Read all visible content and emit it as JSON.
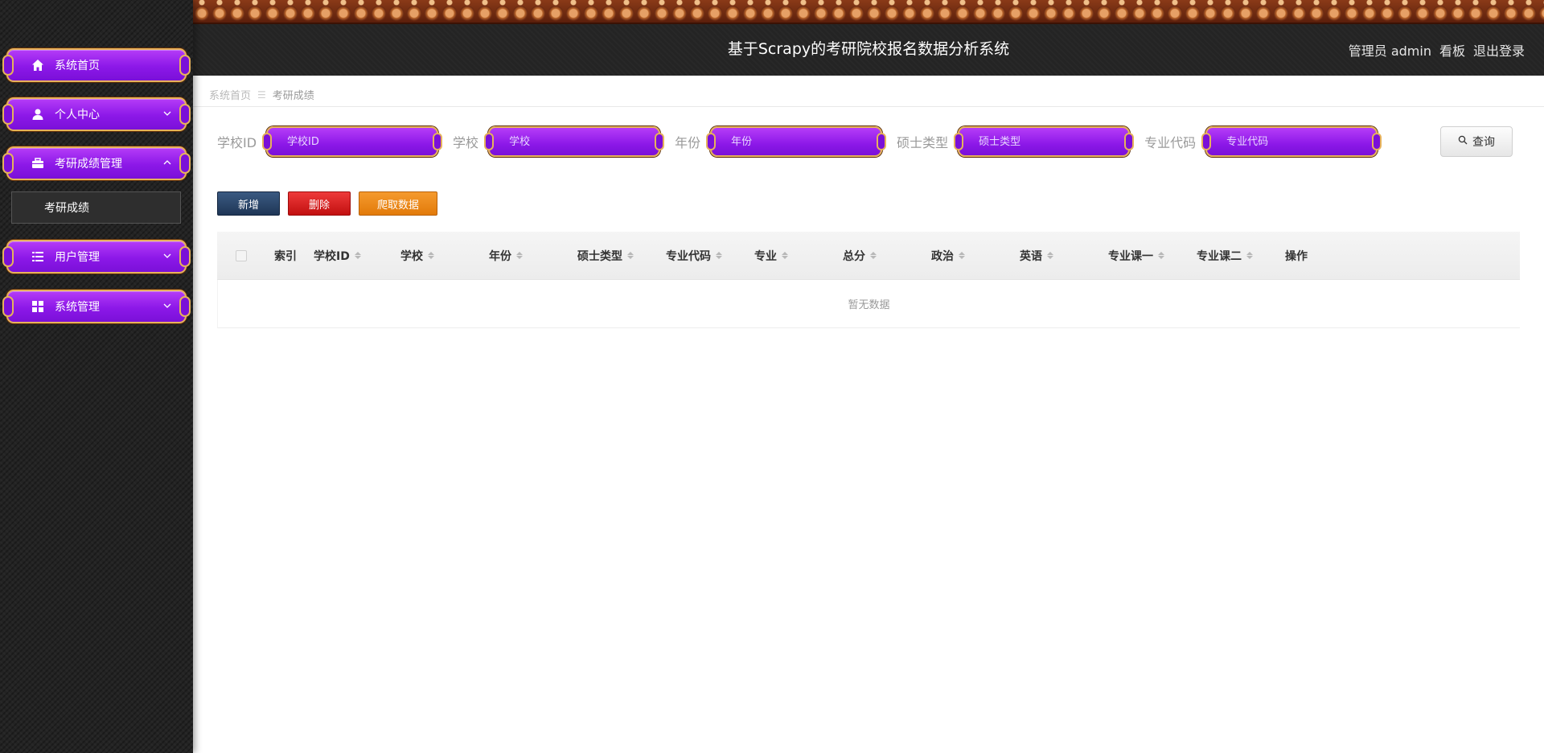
{
  "header": {
    "title": "基于Scrapy的考研院校报名数据分析系统",
    "user": "管理员 admin",
    "dashboard": "看板",
    "logout": "退出登录"
  },
  "sidebar": {
    "items": [
      {
        "label": "系统首页",
        "icon": "home-icon"
      },
      {
        "label": "个人中心",
        "icon": "user-icon"
      },
      {
        "label": "考研成绩管理",
        "icon": "briefcase-icon"
      },
      {
        "label": "用户管理",
        "icon": "list-icon"
      },
      {
        "label": "系统管理",
        "icon": "grid-icon"
      }
    ],
    "sub_item": "考研成绩"
  },
  "breadcrumb": {
    "home": "系统首页",
    "separator": "☰",
    "current": "考研成绩"
  },
  "filters": {
    "school_id": {
      "label": "学校ID",
      "placeholder": "学校ID"
    },
    "school": {
      "label": "学校",
      "placeholder": "学校"
    },
    "year": {
      "label": "年份",
      "placeholder": "年份"
    },
    "degree_type": {
      "label": "硕士类型",
      "placeholder": "硕士类型"
    },
    "major_code": {
      "label": "专业代码",
      "placeholder": "专业代码"
    },
    "search_label": "查询"
  },
  "actions": {
    "add": "新增",
    "delete": "删除",
    "crawl": "爬取数据"
  },
  "table": {
    "columns": [
      "索引",
      "学校ID",
      "学校",
      "年份",
      "硕士类型",
      "专业代码",
      "专业",
      "总分",
      "政治",
      "英语",
      "专业课一",
      "专业课二",
      "操作"
    ],
    "empty": "暂无数据"
  },
  "colors": {
    "accent_purple": "#8c18e8",
    "accent_gold": "#e6b25b",
    "btn_add": "#1f3656",
    "btn_delete": "#c21010",
    "btn_crawl": "#e27a09"
  }
}
